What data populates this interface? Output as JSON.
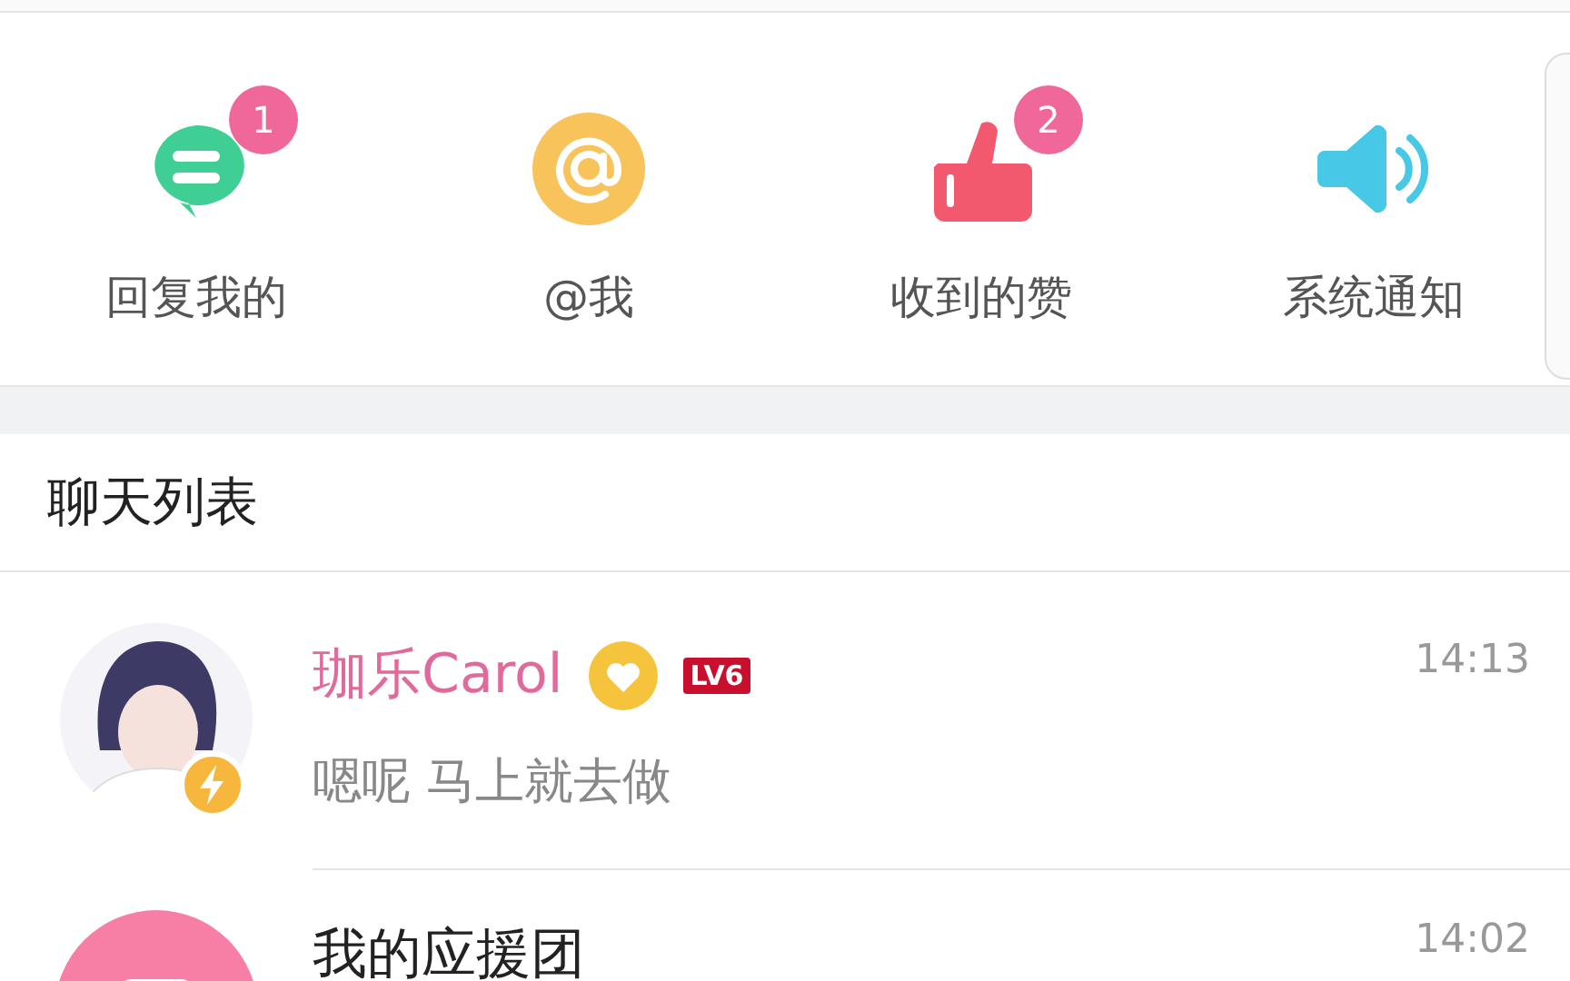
{
  "notifications": [
    {
      "kind": "reply",
      "label": "回复我的",
      "badge": "1"
    },
    {
      "kind": "at",
      "label": "@我"
    },
    {
      "kind": "like",
      "label": "收到的赞",
      "badge": "2"
    },
    {
      "kind": "system",
      "label": "系统通知"
    }
  ],
  "chat_list": {
    "title": "聊天列表",
    "chats": [
      {
        "kind": "user",
        "name": "珈乐Carol",
        "vip": true,
        "level_badge": "LV6",
        "time": "14:13",
        "preview": "嗯呢 马上就去做"
      },
      {
        "kind": "group",
        "name": "我的应援团",
        "vip": false,
        "time": "14:02"
      }
    ]
  }
}
